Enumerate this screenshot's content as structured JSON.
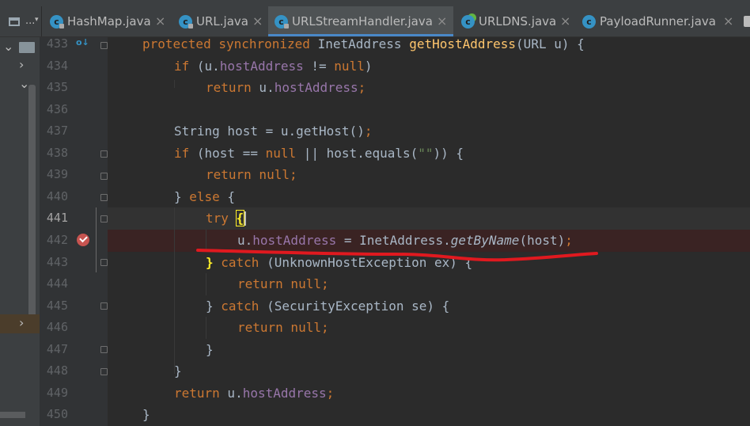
{
  "project": {
    "label": "..."
  },
  "tabs": [
    {
      "label": "HashMap.java",
      "icon": "class-icon"
    },
    {
      "label": "URL.java",
      "icon": "class-icon"
    },
    {
      "label": "URLStreamHandler.java",
      "icon": "class-icon",
      "active": true
    },
    {
      "label": "URLDNS.java",
      "icon": "class-icon"
    },
    {
      "label": "PayloadRunner.java",
      "icon": "class-icon"
    }
  ],
  "editor": {
    "lines": [
      {
        "num": "433"
      },
      {
        "num": "434"
      },
      {
        "num": "435"
      },
      {
        "num": "436"
      },
      {
        "num": "437"
      },
      {
        "num": "438"
      },
      {
        "num": "439"
      },
      {
        "num": "440"
      },
      {
        "num": "441"
      },
      {
        "num": "442"
      },
      {
        "num": "443"
      },
      {
        "num": "444"
      },
      {
        "num": "445"
      },
      {
        "num": "446"
      },
      {
        "num": "447"
      },
      {
        "num": "448"
      },
      {
        "num": "449"
      },
      {
        "num": "450"
      }
    ],
    "code": {
      "l433_kw1": "protected",
      "l433_kw2": "synchronized",
      "l433_type": "InetAddress",
      "l433_fn": "getHostAddress",
      "l433_rest": "(URL u) {",
      "l434_kw": "if",
      "l434_a": " (u.",
      "l434_field": "hostAddress",
      "l434_b": " != ",
      "l434_null": "null",
      "l434_c": ")",
      "l435_kw": "return",
      "l435_a": " u.",
      "l435_field": "hostAddress",
      "l435_semi": ";",
      "l437_a": "String host = u.getHost()",
      "l437_semi": ";",
      "l438_kw": "if",
      "l438_a": " (host == ",
      "l438_null": "null",
      "l438_b": " || host.equals(",
      "l438_str": "\"\"",
      "l438_c": ")) {",
      "l439_kw": "return",
      "l439_null": " null",
      "l439_semi": ";",
      "l440_a": "} ",
      "l440_kw": "else",
      "l440_b": " {",
      "l441_kw": "try",
      "l441_brace": "{",
      "l442_a": "u.",
      "l442_field": "hostAddress",
      "l442_b": " = InetAddress.",
      "l442_fn": "getByName",
      "l442_c": "(host)",
      "l442_semi": ";",
      "l443_brace": "}",
      "l443_kw": " catch",
      "l443_a": " (UnknownHostException ex) {",
      "l444_kw": "return",
      "l444_null": " null",
      "l444_semi": ";",
      "l445_a": "} ",
      "l445_kw": "catch",
      "l445_b": " (SecurityException se) {",
      "l446_kw": "return",
      "l446_null": " null",
      "l446_semi": ";",
      "l447_a": "}",
      "l448_a": "}",
      "l449_kw": "return",
      "l449_a": " u.",
      "l449_field": "hostAddress",
      "l449_semi": ";",
      "l450_a": "}"
    }
  },
  "colors": {
    "keyword": "#cc7832",
    "method": "#ffc66d",
    "field": "#9876aa",
    "string": "#6a8759",
    "text": "#a9b7c6",
    "breakpoint": "#c75450",
    "annotation_underline": "#e0191f",
    "tab_accent": "#4a88c7"
  }
}
